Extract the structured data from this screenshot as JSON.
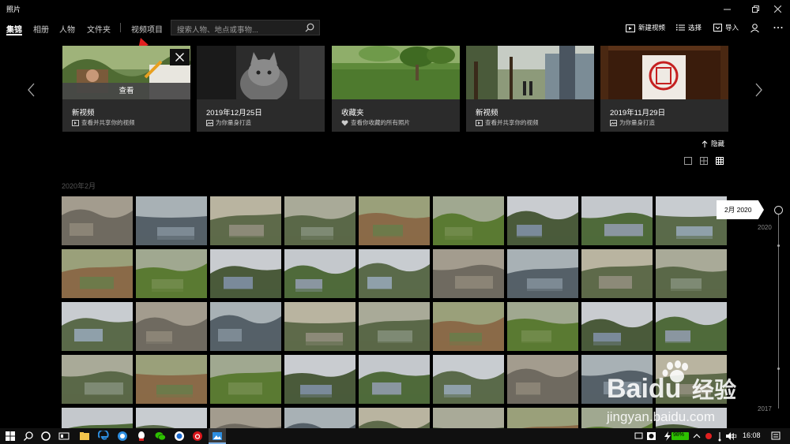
{
  "window": {
    "title": "照片"
  },
  "nav": {
    "tabs": [
      "集锦",
      "相册",
      "人物",
      "文件夹",
      "视频项目"
    ],
    "search_placeholder": "搜索人物、地点或事物..."
  },
  "commands": {
    "new_video": "新建视频",
    "select": "选择",
    "import": "导入"
  },
  "cards": [
    {
      "title": "",
      "subtitle": "",
      "overlay": "查看",
      "icon": "video-icon"
    },
    {
      "title": "2019年12月25日",
      "subtitle": "为你量身打造",
      "icon": "album-icon"
    },
    {
      "title": "收藏夹",
      "subtitle": "查看你收藏的所有照片",
      "icon": "heart-icon"
    },
    {
      "title": "新视频",
      "subtitle": "查看并共享你的视频",
      "icon": "video-icon"
    },
    {
      "title": "2019年11月29日",
      "subtitle": "为你量身打造",
      "icon": "album-icon"
    }
  ],
  "card0": {
    "title": "新视频",
    "subtitle": "查看并共享你的视频"
  },
  "hide_label": "隐藏",
  "date_header": "2020年2月",
  "timeline": {
    "bubble": "2月 2020",
    "year_top": "2020",
    "year_bottom": "2017"
  },
  "watermark": {
    "brand": "Baidu",
    "cn": "经验",
    "url": "jingyan.baidu.com"
  },
  "taskbar": {
    "battery": "98%",
    "ime": "中",
    "clock": "16:08"
  },
  "colors": {
    "background": "#000000",
    "card": "#2b2b2b",
    "accent": "#7fb2e5",
    "arrow": "#e02020"
  }
}
